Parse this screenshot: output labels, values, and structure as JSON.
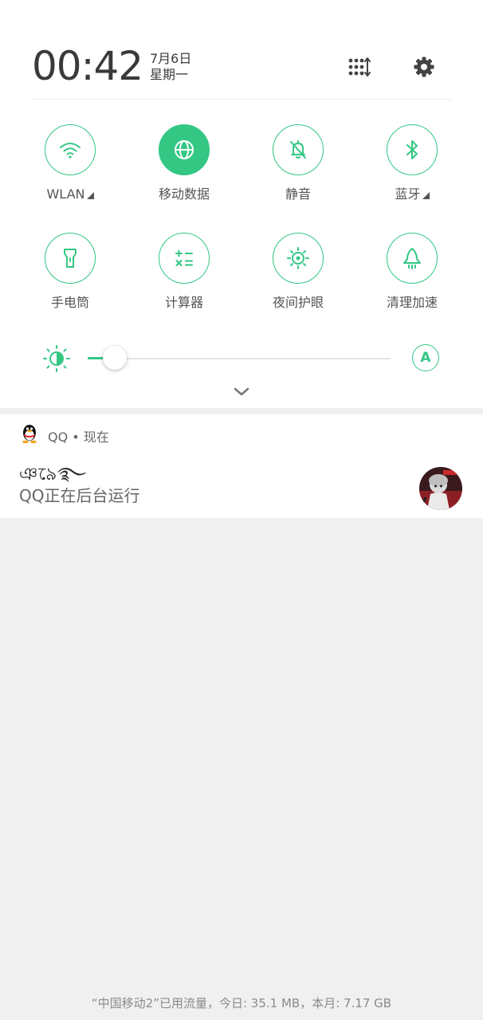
{
  "status": {
    "time": "00:42",
    "date": "7月6日",
    "weekday": "星期一"
  },
  "header_icons": [
    "edit-tiles-icon",
    "settings-gear-icon"
  ],
  "accent_color": "#33c783",
  "quick_tiles": [
    {
      "label": "WLAN",
      "icon": "wifi-icon",
      "active": false,
      "has_submenu": true
    },
    {
      "label": "移动数据",
      "icon": "globe-icon",
      "active": true,
      "has_submenu": false
    },
    {
      "label": "静音",
      "icon": "bell-off-icon",
      "active": false,
      "has_submenu": false
    },
    {
      "label": "蓝牙",
      "icon": "bluetooth-icon",
      "active": false,
      "has_submenu": true
    },
    {
      "label": "手电筒",
      "icon": "flashlight-icon",
      "active": false,
      "has_submenu": false
    },
    {
      "label": "计算器",
      "icon": "calculator-icon",
      "active": false,
      "has_submenu": false
    },
    {
      "label": "夜间护眼",
      "icon": "eye-comfort-icon",
      "active": false,
      "has_submenu": false
    },
    {
      "label": "清理加速",
      "icon": "rocket-icon",
      "active": false,
      "has_submenu": false
    }
  ],
  "brightness": {
    "level": 0.09,
    "auto_label": "A"
  },
  "notification": {
    "app": "QQ",
    "separator": "•",
    "time": "现在",
    "title": "ঞ৯ে࿐",
    "text": "QQ正在后台运行"
  },
  "footer": {
    "data_usage": "“中国移动2”已用流量，今日: 35.1 MB，本月: 7.17 GB"
  }
}
